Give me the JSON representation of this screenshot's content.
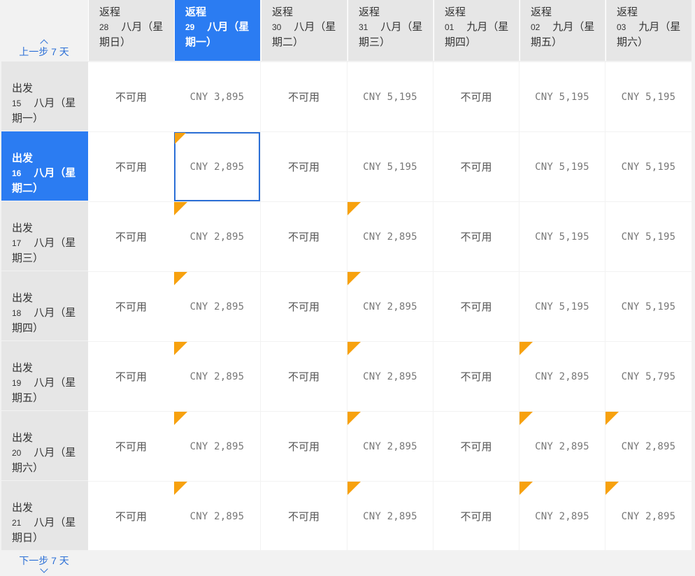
{
  "nav": {
    "prev_label": "上一步 7 天",
    "next_label": "下一步 7 天"
  },
  "return_label": "返程",
  "depart_label": "出发",
  "unavailable_label": "不可用",
  "colors": {
    "accent": "#2b7cf2",
    "flag": "#f7a10e",
    "header_bg": "#e6e6e6"
  },
  "columns": [
    {
      "num": "28",
      "month": "八月（星",
      "weekday": "期日）"
    },
    {
      "num": "29",
      "month": "八月（星",
      "weekday": "期一）"
    },
    {
      "num": "30",
      "month": "八月（星",
      "weekday": "期二）"
    },
    {
      "num": "31",
      "month": "八月（星",
      "weekday": "期三）"
    },
    {
      "num": "01",
      "month": "九月（星",
      "weekday": "期四）"
    },
    {
      "num": "02",
      "month": "九月（星",
      "weekday": "期五）"
    },
    {
      "num": "03",
      "month": "九月（星",
      "weekday": "期六）"
    }
  ],
  "rows": [
    {
      "num": "15",
      "month": "八月（星",
      "weekday": "期一）"
    },
    {
      "num": "16",
      "month": "八月（星",
      "weekday": "期二）"
    },
    {
      "num": "17",
      "month": "八月（星",
      "weekday": "期三）"
    },
    {
      "num": "18",
      "month": "八月（星",
      "weekday": "期四）"
    },
    {
      "num": "19",
      "month": "八月（星",
      "weekday": "期五）"
    },
    {
      "num": "20",
      "month": "八月（星",
      "weekday": "期六）"
    },
    {
      "num": "21",
      "month": "八月（星",
      "weekday": "期日）"
    }
  ],
  "selected": {
    "row": 1,
    "col": 1
  },
  "prices": [
    [
      "",
      "CNY 3,895",
      "",
      "CNY 5,195",
      "",
      "CNY 5,195",
      "CNY 5,195"
    ],
    [
      "",
      "CNY 2,895",
      "",
      "CNY 5,195",
      "",
      "CNY 5,195",
      "CNY 5,195"
    ],
    [
      "",
      "CNY 2,895",
      "",
      "CNY 2,895",
      "",
      "CNY 5,195",
      "CNY 5,195"
    ],
    [
      "",
      "CNY 2,895",
      "",
      "CNY 2,895",
      "",
      "CNY 5,195",
      "CNY 5,195"
    ],
    [
      "",
      "CNY 2,895",
      "",
      "CNY 2,895",
      "",
      "CNY 2,895",
      "CNY 5,795"
    ],
    [
      "",
      "CNY 2,895",
      "",
      "CNY 2,895",
      "",
      "CNY 2,895",
      "CNY 2,895"
    ],
    [
      "",
      "CNY 2,895",
      "",
      "CNY 2,895",
      "",
      "CNY 2,895",
      "CNY 2,895"
    ]
  ],
  "flags": [
    [
      0,
      0,
      0,
      0,
      0,
      0,
      0
    ],
    [
      0,
      1,
      0,
      0,
      0,
      0,
      0
    ],
    [
      0,
      1,
      0,
      1,
      0,
      0,
      0
    ],
    [
      0,
      1,
      0,
      1,
      0,
      0,
      0
    ],
    [
      0,
      1,
      0,
      1,
      0,
      1,
      0
    ],
    [
      0,
      1,
      0,
      1,
      0,
      1,
      1
    ],
    [
      0,
      1,
      0,
      1,
      0,
      1,
      1
    ]
  ]
}
